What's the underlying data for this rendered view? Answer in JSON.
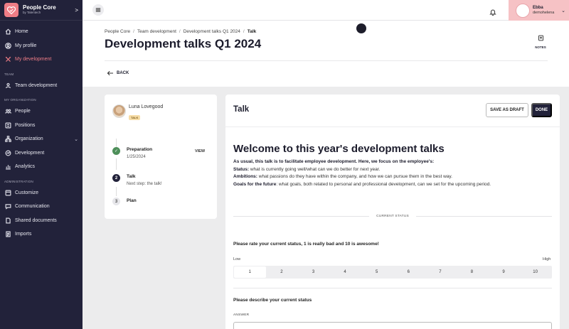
{
  "brand": {
    "name": "People Core",
    "sub": "by Talentech",
    "toggle": ">"
  },
  "sidebar": {
    "top_items": [
      {
        "label": "Home",
        "icon": "home-icon"
      },
      {
        "label": "My profile",
        "icon": "user-circle-icon"
      },
      {
        "label": "My development",
        "icon": "tools-icon",
        "active": true
      }
    ],
    "section_team": "TEAM",
    "team_items": [
      {
        "label": "Team development",
        "icon": "team-icon"
      }
    ],
    "section_org": "MY ORGANIZATION",
    "org_items": [
      {
        "label": "People",
        "icon": "people-icon"
      },
      {
        "label": "Positions",
        "icon": "positions-icon"
      },
      {
        "label": "Organization",
        "icon": "organization-icon",
        "chevron": "⌄"
      },
      {
        "label": "Development",
        "icon": "development-icon"
      },
      {
        "label": "Analytics",
        "icon": "analytics-icon"
      }
    ],
    "section_admin": "ADMINISTRATION",
    "admin_items": [
      {
        "label": "Customize",
        "icon": "customize-icon"
      },
      {
        "label": "Communication",
        "icon": "communication-icon"
      },
      {
        "label": "Shared documents",
        "icon": "document-icon"
      },
      {
        "label": "Imports",
        "icon": "imports-icon"
      }
    ]
  },
  "topbar": {
    "user_name": "Ebba",
    "user_sub": "demohelena",
    "user_chevron": "⌄"
  },
  "header": {
    "breadcrumbs": [
      "People Core",
      "Team development",
      "Development talks Q1 2024",
      "Talk"
    ],
    "sep": "/",
    "title": "Development talks Q1 2024",
    "notes_label": "NOTES",
    "back_label": "BACK"
  },
  "left_card": {
    "person_name": "Luna Lovegood",
    "badge": "TALK",
    "steps": [
      {
        "title": "Preparation",
        "sub": "1/25/2024",
        "icon": "✓",
        "action": "VIEW"
      },
      {
        "title": "Talk",
        "sub": "Next step: the talk!",
        "icon": "2"
      },
      {
        "title": "Plan",
        "sub": "",
        "icon": "3"
      }
    ]
  },
  "main": {
    "title": "Talk",
    "draft_label": "SAVE AS DRAFT",
    "done_label": "DONE",
    "welcome": "Welcome to this year's development talks",
    "intro_lead": "As usual, this talk is to facilitate employee development. Here, we focus on the employee's:",
    "status_label": "Status:",
    "status_text": " what is currently going well/what can we do better for next year.",
    "ambitions_label": "Ambitions:",
    "ambitions_text": " what passions do they have within the company, and how we can pursue them in the best way.",
    "goals_label": "Goals for the future",
    "goals_text": ": what goals,  both related to personal and professional development, can we set for the upcoming period.",
    "section_label": "CURRENT STATUS",
    "q1": "Please rate your current status, 1 is really bad and 10 is awesome!",
    "low_label": "Low",
    "high_label": "High",
    "scale": [
      "1",
      "2",
      "3",
      "4",
      "5",
      "6",
      "7",
      "8",
      "9",
      "10"
    ],
    "selected": "1",
    "q2": "Please describe your current status",
    "answer_label": "ANSWER"
  }
}
